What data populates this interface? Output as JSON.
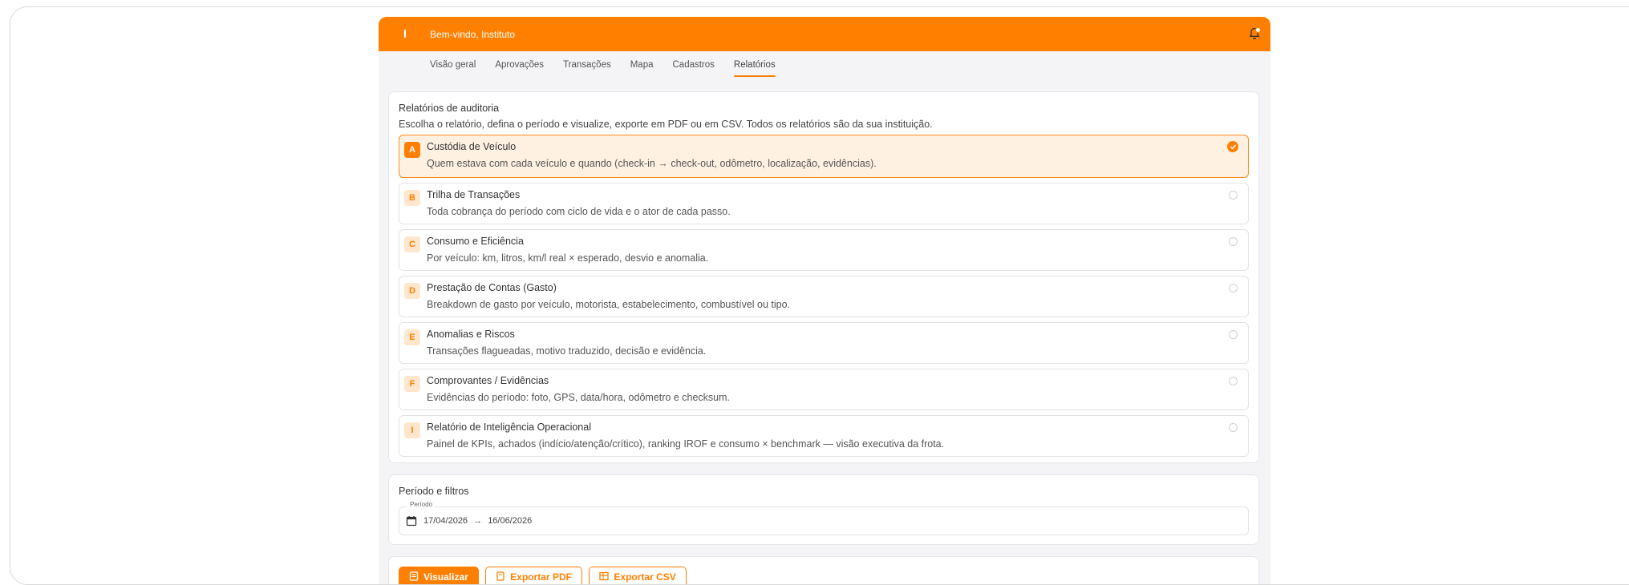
{
  "header": {
    "logo_letter": "I",
    "welcome": "Bem-vindo, Instituto"
  },
  "tabs": [
    {
      "label": "Visão geral"
    },
    {
      "label": "Aprovações"
    },
    {
      "label": "Transações"
    },
    {
      "label": "Mapa"
    },
    {
      "label": "Cadastros"
    },
    {
      "label": "Relatórios",
      "active": true
    }
  ],
  "reports_card": {
    "title": "Relatórios de auditoria",
    "subtitle": "Escolha o relatório, defina o período e visualize, exporte em PDF ou em CSV. Todos os relatórios são da sua instituição.",
    "items": [
      {
        "code": "A",
        "title": "Custódia de Veículo",
        "desc": "Quem estava com cada veículo e quando (check-in → check-out, odômetro, localização, evidências).",
        "selected": true
      },
      {
        "code": "B",
        "title": "Trilha de Transações",
        "desc": "Toda cobrança do período com ciclo de vida e o ator de cada passo.",
        "selected": false
      },
      {
        "code": "C",
        "title": "Consumo e Eficiência",
        "desc": "Por veículo: km, litros, km/l real × esperado, desvio e anomalia.",
        "selected": false
      },
      {
        "code": "D",
        "title": "Prestação de Contas (Gasto)",
        "desc": "Breakdown de gasto por veículo, motorista, estabelecimento, combustível ou tipo.",
        "selected": false
      },
      {
        "code": "E",
        "title": "Anomalias e Riscos",
        "desc": "Transações flagueadas, motivo traduzido, decisão e evidência.",
        "selected": false
      },
      {
        "code": "F",
        "title": "Comprovantes / Evidências",
        "desc": "Evidências do período: foto, GPS, data/hora, odômetro e checksum.",
        "selected": false
      },
      {
        "code": "I",
        "title": "Relatório de Inteligência Operacional",
        "desc": "Painel de KPIs, achados (indício/atenção/crítico), ranking IROF e consumo × benchmark — visão executiva da frota.",
        "selected": false
      }
    ]
  },
  "period_card": {
    "title": "Período e filtros",
    "field_label": "Período",
    "start": "17/04/2026",
    "arrow": "→",
    "end": "16/06/2026"
  },
  "actions": {
    "view": "Visualizar",
    "pdf": "Exportar PDF",
    "csv": "Exportar CSV"
  },
  "colors": {
    "accent": "#ff8000",
    "selected_bg": "#fff1e2",
    "badge_bg": "#ffe6cc"
  }
}
